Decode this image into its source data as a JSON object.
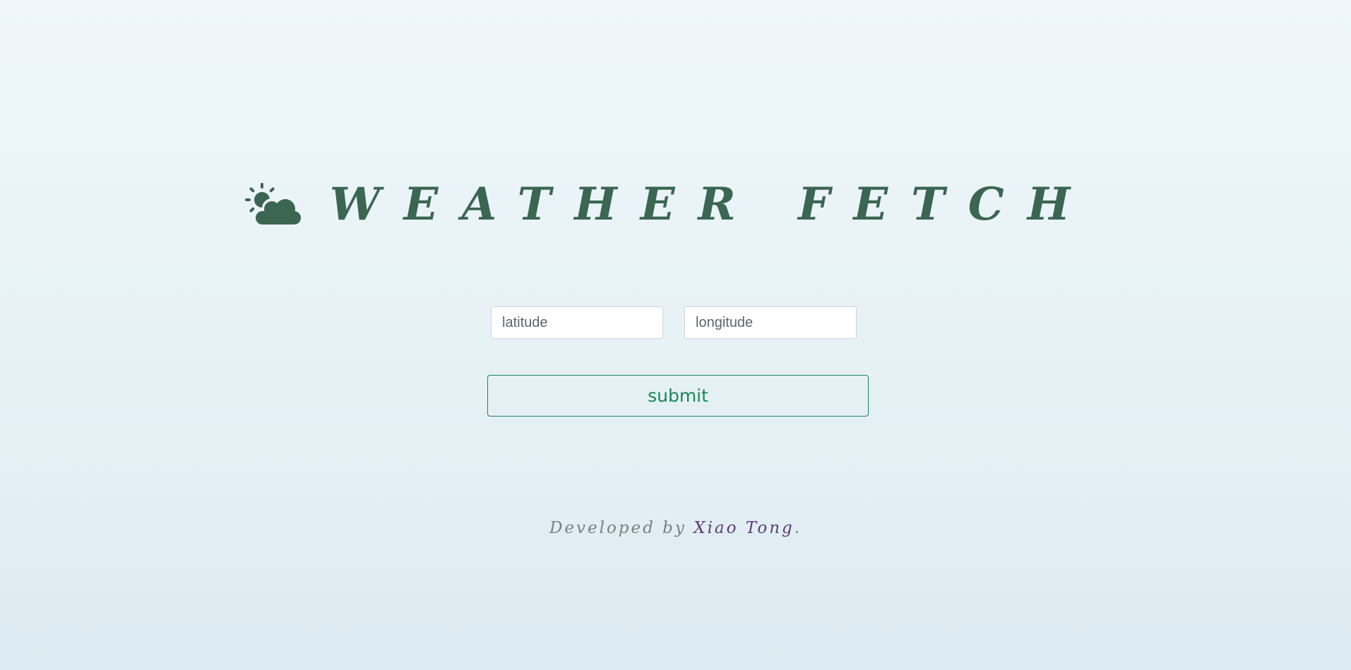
{
  "header": {
    "icon": "sun-behind-cloud-icon",
    "title": "WEATHER FETCH"
  },
  "form": {
    "latitude_placeholder": "latitude",
    "longitude_placeholder": "longitude",
    "submit_label": "submit"
  },
  "footer": {
    "prefix": "Developed by ",
    "author": "Xiao Tong",
    "suffix": "."
  },
  "colors": {
    "title": "#3b6652",
    "accent": "#198754",
    "author": "#5e3b78",
    "footer_text": "#7b7f83"
  }
}
